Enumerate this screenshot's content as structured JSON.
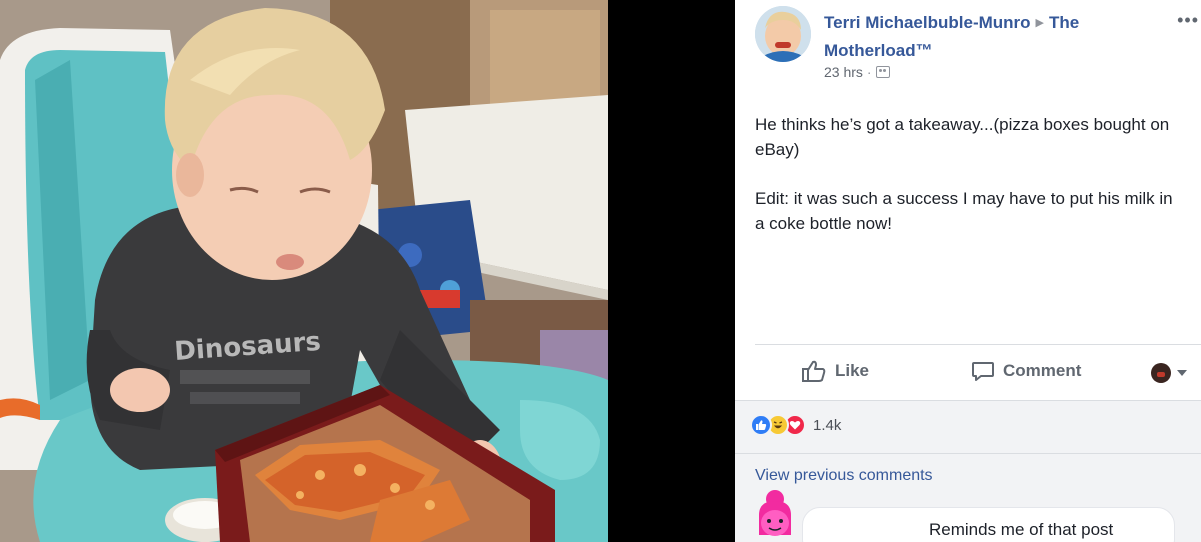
{
  "post": {
    "author": "Terri Michaelbuble-Munro",
    "group": "The Motherload™",
    "time": "23 hrs",
    "text_line1": "He thinks he’s got a takeaway...(pizza boxes bought on eBay)",
    "text_line2": "Edit: it was such a success I may have to put his milk in a coke bottle now!",
    "shirt_text": "Dinosaurs"
  },
  "actions": {
    "like_label": "Like",
    "comment_label": "Comment"
  },
  "reactions": {
    "count": "1.4k"
  },
  "comments": {
    "view_previous": "View previous comments",
    "first_comment_text": "Reminds me of that post"
  },
  "colors": {
    "link": "#365899",
    "like_blue": "#2f7df6",
    "love_red": "#f0284a",
    "haha_yellow": "#f7c935"
  },
  "icons": {
    "more": "more-icon",
    "like": "thumbs-up-icon",
    "comment": "speech-bubble-icon",
    "group_audience": "group-icon"
  }
}
